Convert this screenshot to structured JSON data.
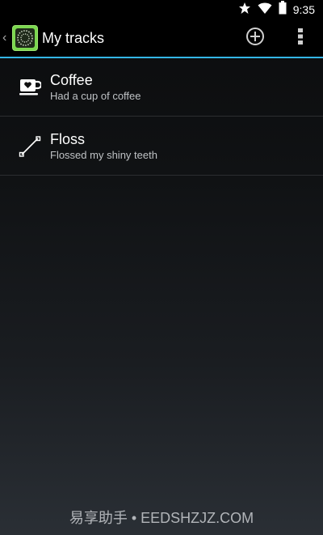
{
  "status_bar": {
    "time": "9:35",
    "icons": [
      "star-icon",
      "wifi-icon",
      "battery-icon"
    ]
  },
  "action_bar": {
    "title": "My tracks",
    "actions": [
      "add-circle-icon",
      "overflow-menu-icon"
    ],
    "accent_color": "#33b5e5"
  },
  "tracks": [
    {
      "title": "Coffee",
      "subtitle": "Had a cup of coffee",
      "icon": "coffee-cup-icon"
    },
    {
      "title": "Floss",
      "subtitle": "Flossed my shiny teeth",
      "icon": "line-icon"
    }
  ],
  "watermark": "易享助手 • EEDSHZJZ.COM"
}
